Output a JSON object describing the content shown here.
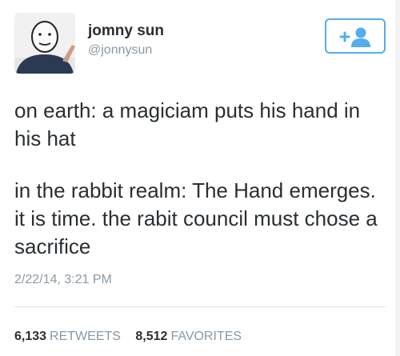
{
  "colors": {
    "accent": "#55acee",
    "text": "#292f33",
    "muted": "#8899a6",
    "divider": "#e1e8ed"
  },
  "user": {
    "display_name": "jomny sun",
    "handle": "@jonnysun",
    "avatar": "avatar-photo",
    "follow_icon": "add-user-icon"
  },
  "tweet": {
    "paragraphs": [
      "on earth: a magiciam puts his hand in his hat",
      "in the rabbit realm: The Hand emerges. it is time. the rabit council must chose a sacrifice"
    ],
    "timestamp": "2/22/14, 3:21 PM"
  },
  "stats": {
    "retweets_count": "6,133",
    "retweets_label": "RETWEETS",
    "favorites_count": "8,512",
    "favorites_label": "FAVORITES"
  }
}
